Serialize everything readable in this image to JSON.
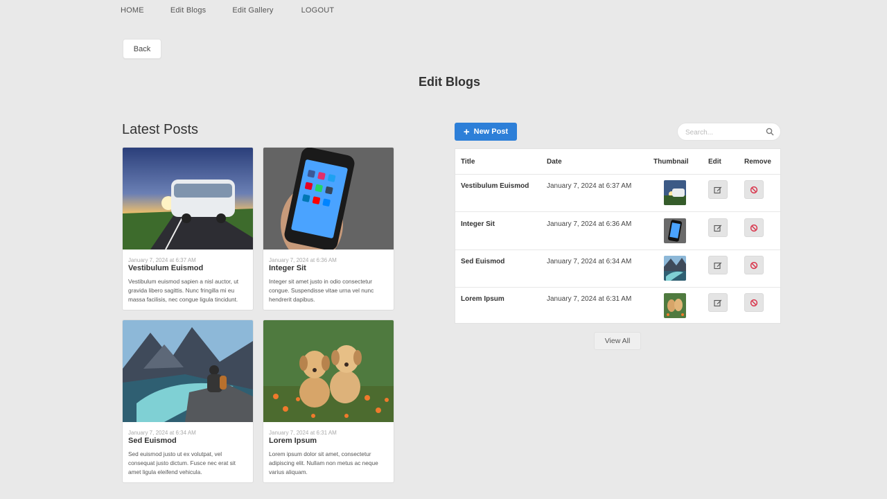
{
  "nav": {
    "items": [
      {
        "label": "HOME"
      },
      {
        "label": "Edit Blogs"
      },
      {
        "label": "Edit Gallery"
      },
      {
        "label": "LOGOUT"
      }
    ]
  },
  "back_label": "Back",
  "page_title": "Edit Blogs",
  "latest_posts": {
    "heading": "Latest Posts",
    "cards": [
      {
        "date": "January 7, 2024 at 6:37 AM",
        "title": "Vestibulum Euismod",
        "excerpt": "Vestibulum euismod sapien a nisl auctor, ut gravida libero sagittis. Nunc fringilla mi eu massa facilisis, nec congue ligula tincidunt."
      },
      {
        "date": "January 7, 2024 at 6:36 AM",
        "title": "Integer Sit",
        "excerpt": "Integer sit amet justo in odio consectetur congue. Suspendisse vitae urna vel nunc hendrerit dapibus."
      },
      {
        "date": "January 7, 2024 at 6:34 AM",
        "title": "Sed Euismod",
        "excerpt": "Sed euismod justo ut ex volutpat, vel consequat justo dictum. Fusce nec erat sit amet ligula eleifend vehicula."
      },
      {
        "date": "January 7, 2024 at 6:31 AM",
        "title": "Lorem Ipsum",
        "excerpt": "Lorem ipsum dolor sit amet, consectetur adipiscing elit. Nullam non metus ac neque varius aliquam."
      }
    ]
  },
  "toolbar": {
    "new_post_label": "New Post",
    "search_placeholder": "Search..."
  },
  "table": {
    "headers": {
      "title": "Title",
      "date": "Date",
      "thumbnail": "Thumbnail",
      "edit": "Edit",
      "remove": "Remove"
    },
    "rows": [
      {
        "title": "Vestibulum Euismod",
        "date": "January 7, 2024 at 6:37 AM"
      },
      {
        "title": "Integer Sit",
        "date": "January 7, 2024 at 6:36 AM"
      },
      {
        "title": "Sed Euismod",
        "date": "January 7, 2024 at 6:34 AM"
      },
      {
        "title": "Lorem Ipsum",
        "date": "January 7, 2024 at 6:31 AM"
      }
    ]
  },
  "view_all_label": "View All",
  "colors": {
    "background": "#e9e9e9",
    "primary_button": "#2d7fd8",
    "remove_icon": "#d9344b"
  },
  "icons": {
    "new_post": "plus-icon",
    "search": "search-icon",
    "edit": "edit-icon",
    "remove": "remove-icon"
  }
}
